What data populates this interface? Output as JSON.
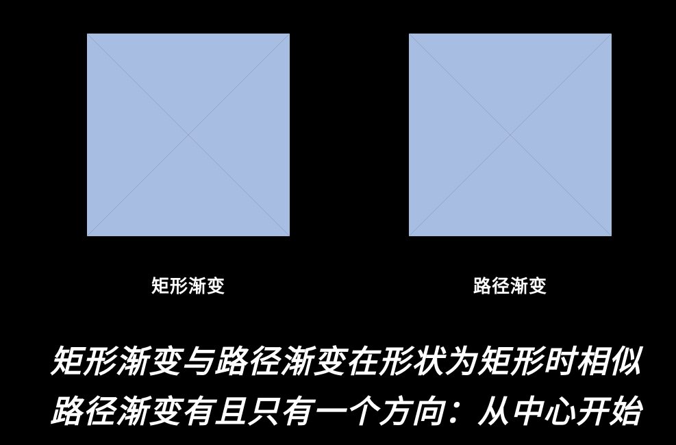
{
  "colors": {
    "background": "#000000",
    "gradient_center": "#ff0000",
    "gradient_edge": "#a8bde2",
    "text": "#ffffff"
  },
  "panels": [
    {
      "label": "矩形渐变"
    },
    {
      "label": "路径渐变"
    }
  ],
  "headlines": [
    "矩形渐变与路径渐变在形状为矩形时相似",
    "路径渐变有且只有一个方向：从中心开始"
  ]
}
